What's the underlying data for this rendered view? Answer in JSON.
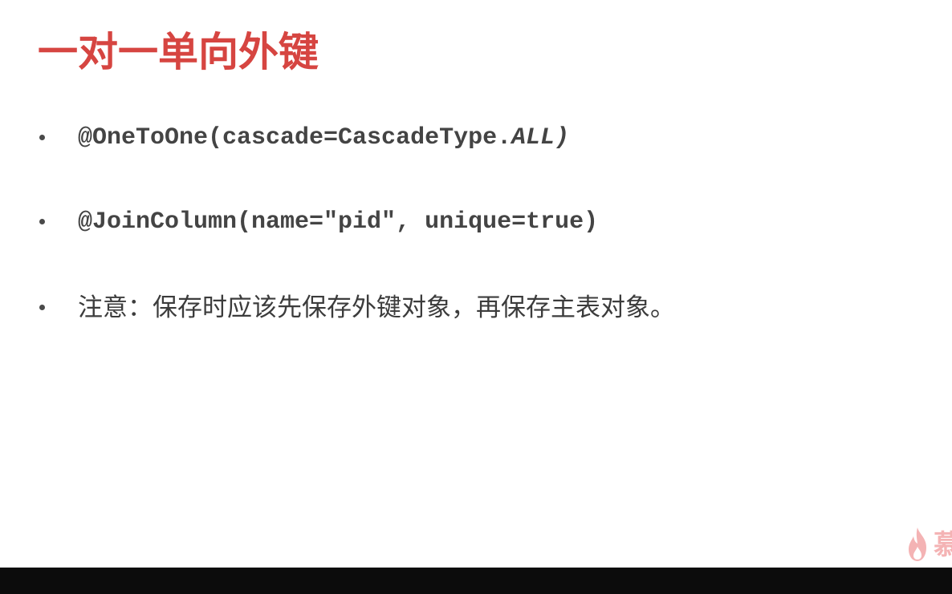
{
  "slide": {
    "title": "一对一单向外键",
    "bullets": [
      {
        "code": "@OneToOne(cascade=CascadeType.",
        "code_italic": "ALL)"
      },
      {
        "code": "@JoinColumn(name=\"pid\", unique=true)"
      },
      {
        "text": "注意：保存时应该先保存外键对象，再保存主表对象。"
      }
    ],
    "title_color": "#d64541"
  },
  "watermark": {
    "icon": "flame-icon",
    "text": "慕"
  }
}
